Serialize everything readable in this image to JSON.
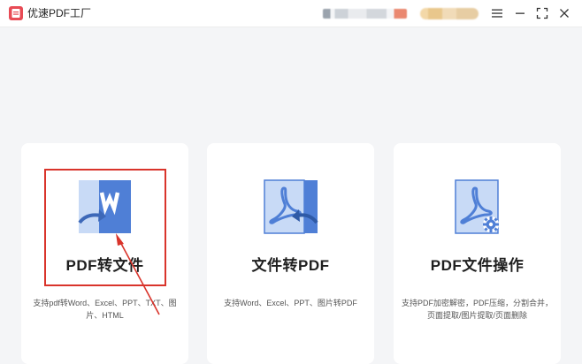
{
  "app": {
    "title": "优速PDF工厂"
  },
  "window_controls": {
    "menu_icon": "hamburger-menu-icon",
    "minimize_icon": "minimize-icon",
    "maximize_icon": "fullscreen-icon",
    "close_icon": "close-icon"
  },
  "cards": [
    {
      "title": "PDF转文件",
      "description": "支持pdf转Word、Excel、PPT、TXT、图片、HTML",
      "icon": "pdf-to-word-icon"
    },
    {
      "title": "文件转PDF",
      "description": "支持Word、Excel、PPT、图片转PDF",
      "icon": "file-to-pdf-icon"
    },
    {
      "title": "PDF文件操作",
      "description": "支持PDF加密解密，PDF压缩，分割合并，页面提取/图片提取/页面删除",
      "icon": "pdf-operations-icon"
    }
  ],
  "colors": {
    "accent_blue": "#4f7fd6",
    "light_blue": "#c8daf6",
    "annotation_red": "#d9342b",
    "logo_red": "#e84b55"
  }
}
